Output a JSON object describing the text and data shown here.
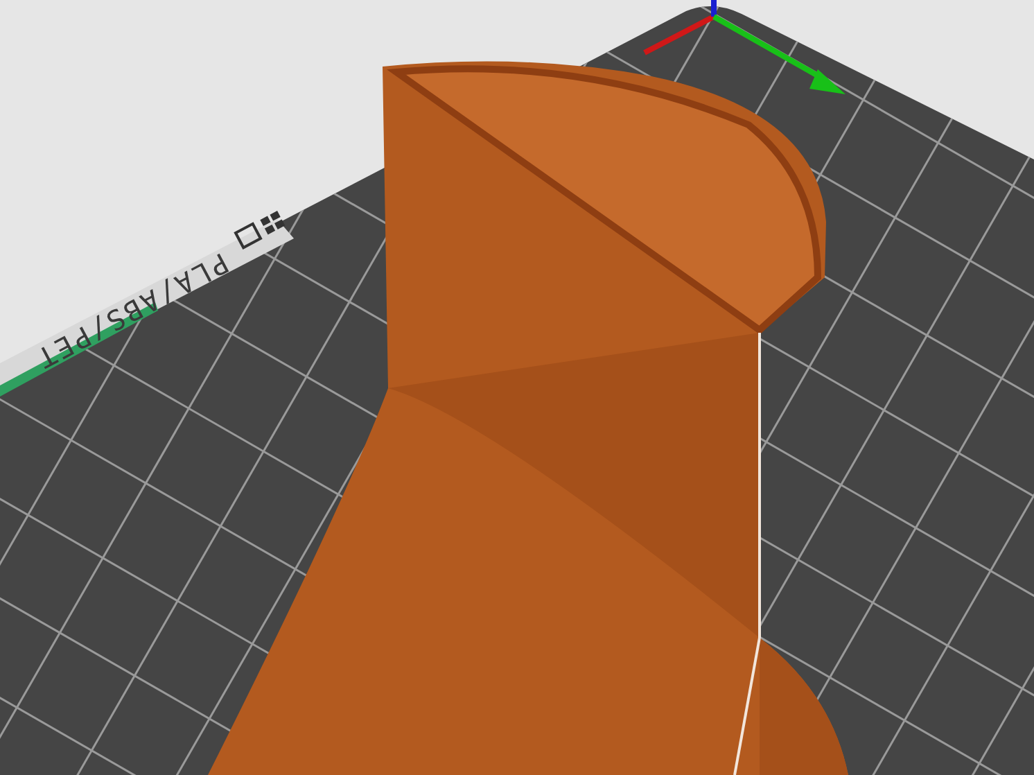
{
  "viewport": {
    "bed_label": "PLA/ABS/PET"
  }
}
